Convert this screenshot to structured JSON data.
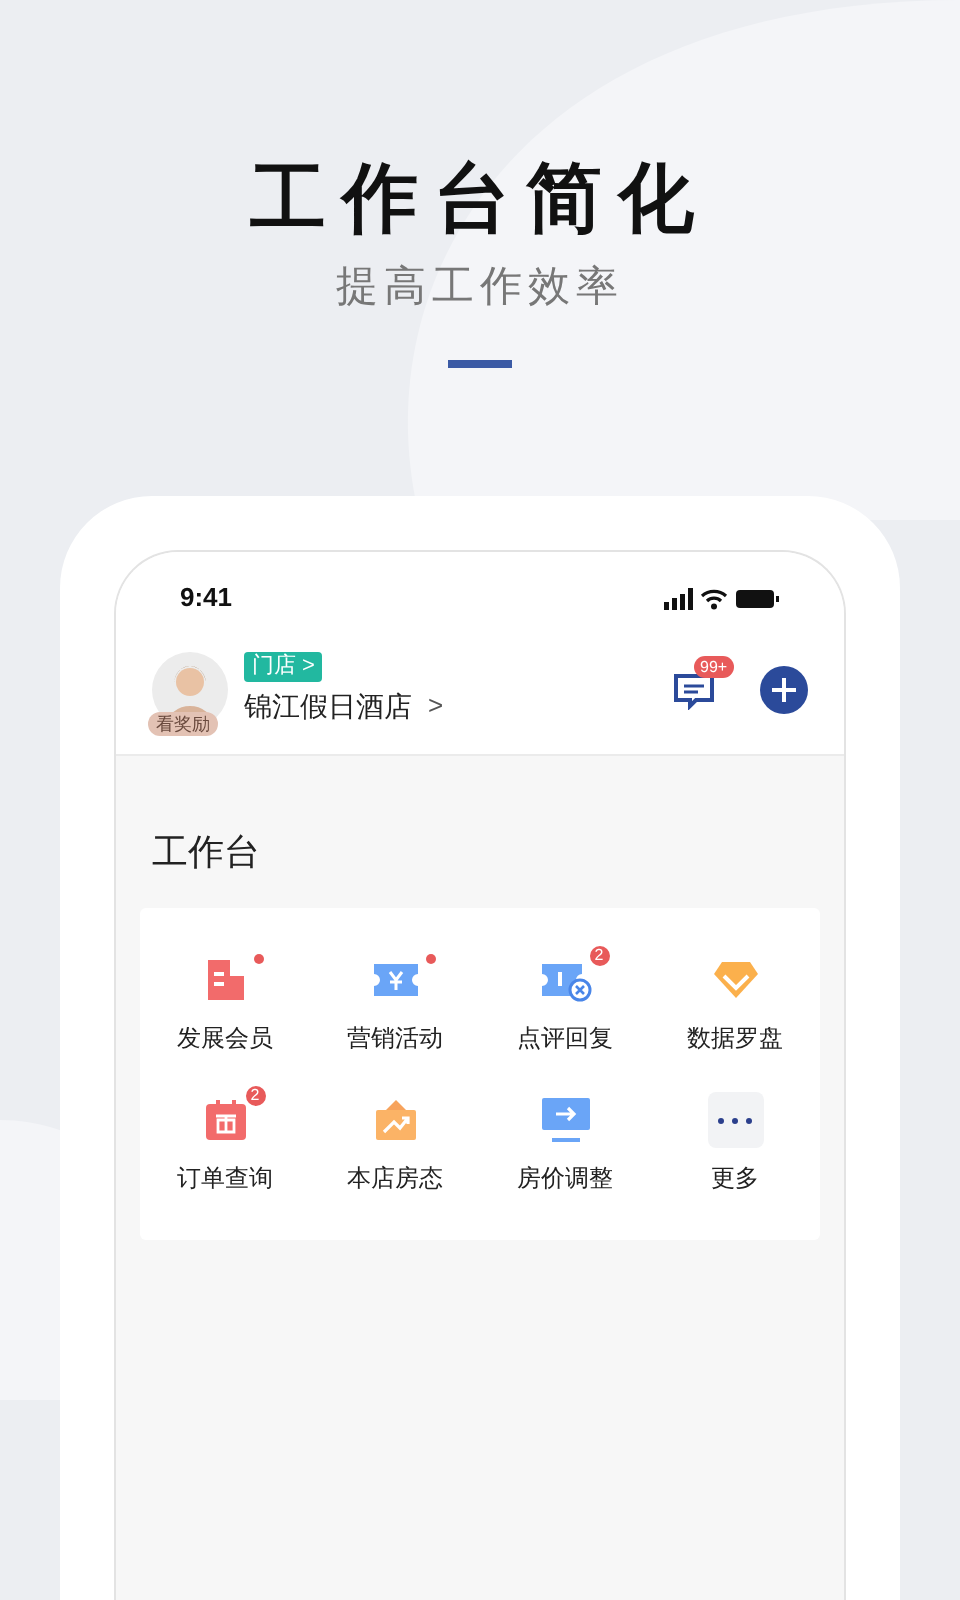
{
  "headline": {
    "title": "工作台简化",
    "subtitle": "提高工作效率"
  },
  "status_bar": {
    "time": "9:41"
  },
  "header": {
    "avatar_badge": "看奖励",
    "store_tag": "门店 >",
    "store_name": "锦江假日酒店",
    "store_arrow": ">",
    "message_count": "99+"
  },
  "workbench": {
    "title": "工作台",
    "items": [
      {
        "label": "发展会员",
        "kind": "member",
        "dot": true
      },
      {
        "label": "营销活动",
        "kind": "coupon",
        "dot": true
      },
      {
        "label": "点评回复",
        "kind": "review",
        "dot": false,
        "count": "2"
      },
      {
        "label": "数据罗盘",
        "kind": "diamond",
        "dot": false
      },
      {
        "label": "订单查询",
        "kind": "gift",
        "dot": false,
        "count": "2"
      },
      {
        "label": "本店房态",
        "kind": "trend",
        "dot": false
      },
      {
        "label": "房价调整",
        "kind": "monitor",
        "dot": false
      },
      {
        "label": "更多",
        "kind": "more",
        "dot": false
      }
    ]
  }
}
